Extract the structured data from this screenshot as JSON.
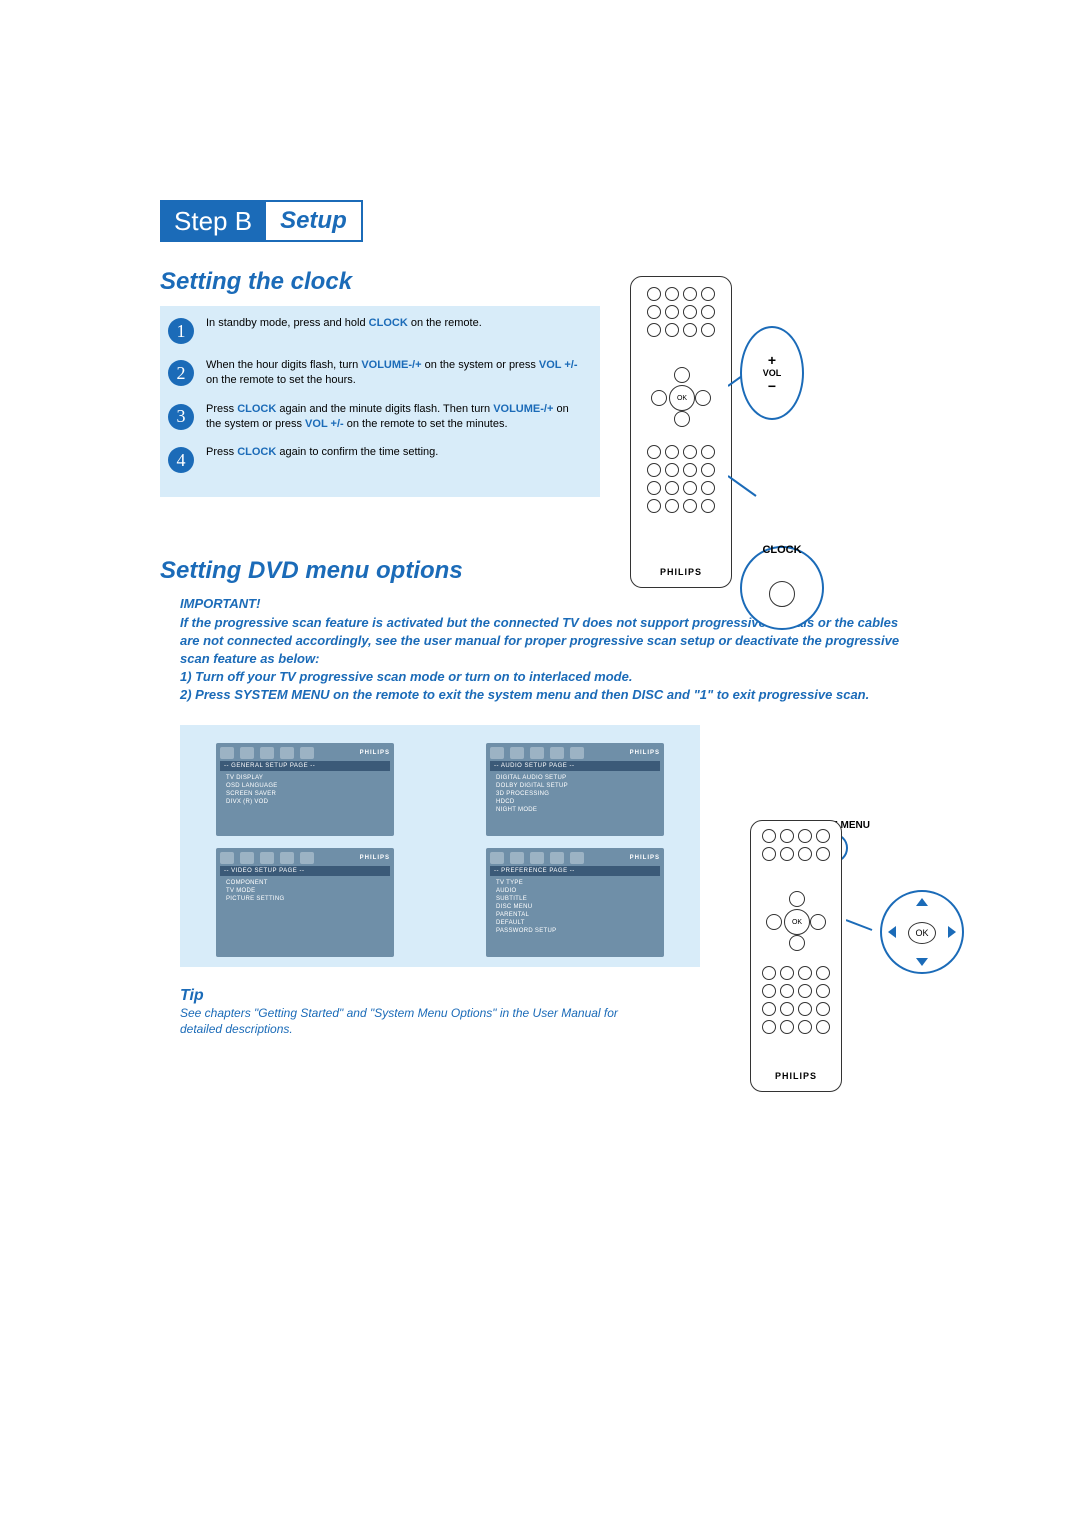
{
  "step_badge": {
    "label": "Step B",
    "subtitle": "Setup"
  },
  "clock": {
    "title": "Setting the clock",
    "steps": [
      {
        "n": "1",
        "pre": "In standby mode, press and hold ",
        "kw": "CLOCK",
        "post": " on the remote."
      },
      {
        "n": "2",
        "pre": "When the hour digits flash, turn ",
        "kw": "VOLUME-/+",
        "mid": " on the system or press ",
        "kw2": "VOL +/-",
        "post": " on the remote to set the hours."
      },
      {
        "n": "3",
        "pre": "Press ",
        "kw": "CLOCK",
        "mid": " again and the minute digits flash. Then turn ",
        "kw2": "VOLUME-/+",
        "mid2": " on the system or press ",
        "kw3": "VOL +/-",
        "post": " on the remote to set the minutes."
      },
      {
        "n": "4",
        "pre": "Press ",
        "kw": "CLOCK",
        "post": " again to confirm the time setting."
      }
    ]
  },
  "remote": {
    "brand": "PHILIPS",
    "ok": "OK",
    "callouts": {
      "vol_plus": "+",
      "vol_label": "VOL",
      "vol_minus": "−",
      "clock_label": "CLOCK",
      "sysmenu_label": "SYSTEM MENU"
    }
  },
  "dvd": {
    "title": "Setting DVD menu options",
    "important_label": "IMPORTANT!",
    "important_text": "If the progressive scan feature is activated but the connected TV does not support progressive signals or the cables are not connected accordingly, see the user manual for proper progressive scan setup or deactivate the progressive scan feature as below:\n1) Turn off your TV progressive scan mode or turn on to interlaced mode.\n2) Press SYSTEM MENU on the remote to exit the system menu and then DISC and \"1\" to exit progressive scan.",
    "menus": [
      {
        "title": "-- GENERAL SETUP PAGE --",
        "items": [
          "TV DISPLAY",
          "OSD LANGUAGE",
          "SCREEN SAVER",
          "DIVX (R) VOD"
        ]
      },
      {
        "title": "-- AUDIO SETUP PAGE --",
        "items": [
          "DIGITAL AUDIO SETUP",
          "DOLBY DIGITAL SETUP",
          "3D PROCESSING",
          "HDCD",
          "NIGHT MODE"
        ]
      },
      {
        "title": "-- VIDEO SETUP PAGE --",
        "items": [
          "COMPONENT",
          "TV MODE",
          "PICTURE SETTING"
        ]
      },
      {
        "title": "-- PREFERENCE PAGE --",
        "items": [
          "TV TYPE",
          "AUDIO",
          "SUBTITLE",
          "DISC MENU",
          "PARENTAL",
          "DEFAULT",
          "PASSWORD SETUP"
        ]
      }
    ],
    "menu_brand": "PHILIPS"
  },
  "tip": {
    "label": "Tip",
    "text": "See chapters \"Getting Started\" and \"System Menu Options\" in the User Manual for detailed descriptions."
  }
}
